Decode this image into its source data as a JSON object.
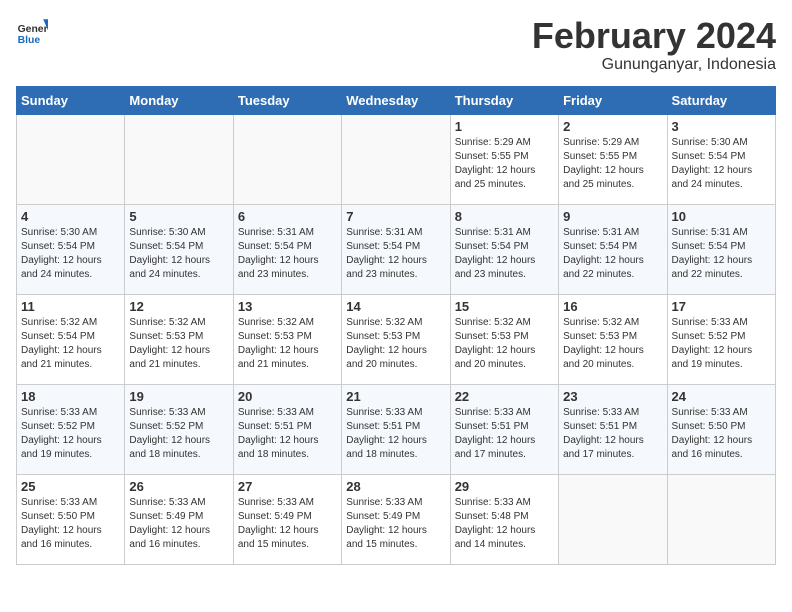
{
  "header": {
    "logo_general": "General",
    "logo_blue": "Blue",
    "month_title": "February 2024",
    "location": "Gununganyar, Indonesia"
  },
  "days_of_week": [
    "Sunday",
    "Monday",
    "Tuesday",
    "Wednesday",
    "Thursday",
    "Friday",
    "Saturday"
  ],
  "weeks": [
    [
      {
        "day": "",
        "empty": true
      },
      {
        "day": "",
        "empty": true
      },
      {
        "day": "",
        "empty": true
      },
      {
        "day": "",
        "empty": true
      },
      {
        "day": "1",
        "sunrise": "5:29 AM",
        "sunset": "5:55 PM",
        "daylight": "12 hours and 25 minutes."
      },
      {
        "day": "2",
        "sunrise": "5:29 AM",
        "sunset": "5:55 PM",
        "daylight": "12 hours and 25 minutes."
      },
      {
        "day": "3",
        "sunrise": "5:30 AM",
        "sunset": "5:54 PM",
        "daylight": "12 hours and 24 minutes."
      }
    ],
    [
      {
        "day": "4",
        "sunrise": "5:30 AM",
        "sunset": "5:54 PM",
        "daylight": "12 hours and 24 minutes."
      },
      {
        "day": "5",
        "sunrise": "5:30 AM",
        "sunset": "5:54 PM",
        "daylight": "12 hours and 24 minutes."
      },
      {
        "day": "6",
        "sunrise": "5:31 AM",
        "sunset": "5:54 PM",
        "daylight": "12 hours and 23 minutes."
      },
      {
        "day": "7",
        "sunrise": "5:31 AM",
        "sunset": "5:54 PM",
        "daylight": "12 hours and 23 minutes."
      },
      {
        "day": "8",
        "sunrise": "5:31 AM",
        "sunset": "5:54 PM",
        "daylight": "12 hours and 23 minutes."
      },
      {
        "day": "9",
        "sunrise": "5:31 AM",
        "sunset": "5:54 PM",
        "daylight": "12 hours and 22 minutes."
      },
      {
        "day": "10",
        "sunrise": "5:31 AM",
        "sunset": "5:54 PM",
        "daylight": "12 hours and 22 minutes."
      }
    ],
    [
      {
        "day": "11",
        "sunrise": "5:32 AM",
        "sunset": "5:54 PM",
        "daylight": "12 hours and 21 minutes."
      },
      {
        "day": "12",
        "sunrise": "5:32 AM",
        "sunset": "5:53 PM",
        "daylight": "12 hours and 21 minutes."
      },
      {
        "day": "13",
        "sunrise": "5:32 AM",
        "sunset": "5:53 PM",
        "daylight": "12 hours and 21 minutes."
      },
      {
        "day": "14",
        "sunrise": "5:32 AM",
        "sunset": "5:53 PM",
        "daylight": "12 hours and 20 minutes."
      },
      {
        "day": "15",
        "sunrise": "5:32 AM",
        "sunset": "5:53 PM",
        "daylight": "12 hours and 20 minutes."
      },
      {
        "day": "16",
        "sunrise": "5:32 AM",
        "sunset": "5:53 PM",
        "daylight": "12 hours and 20 minutes."
      },
      {
        "day": "17",
        "sunrise": "5:33 AM",
        "sunset": "5:52 PM",
        "daylight": "12 hours and 19 minutes."
      }
    ],
    [
      {
        "day": "18",
        "sunrise": "5:33 AM",
        "sunset": "5:52 PM",
        "daylight": "12 hours and 19 minutes."
      },
      {
        "day": "19",
        "sunrise": "5:33 AM",
        "sunset": "5:52 PM",
        "daylight": "12 hours and 18 minutes."
      },
      {
        "day": "20",
        "sunrise": "5:33 AM",
        "sunset": "5:51 PM",
        "daylight": "12 hours and 18 minutes."
      },
      {
        "day": "21",
        "sunrise": "5:33 AM",
        "sunset": "5:51 PM",
        "daylight": "12 hours and 18 minutes."
      },
      {
        "day": "22",
        "sunrise": "5:33 AM",
        "sunset": "5:51 PM",
        "daylight": "12 hours and 17 minutes."
      },
      {
        "day": "23",
        "sunrise": "5:33 AM",
        "sunset": "5:51 PM",
        "daylight": "12 hours and 17 minutes."
      },
      {
        "day": "24",
        "sunrise": "5:33 AM",
        "sunset": "5:50 PM",
        "daylight": "12 hours and 16 minutes."
      }
    ],
    [
      {
        "day": "25",
        "sunrise": "5:33 AM",
        "sunset": "5:50 PM",
        "daylight": "12 hours and 16 minutes."
      },
      {
        "day": "26",
        "sunrise": "5:33 AM",
        "sunset": "5:49 PM",
        "daylight": "12 hours and 16 minutes."
      },
      {
        "day": "27",
        "sunrise": "5:33 AM",
        "sunset": "5:49 PM",
        "daylight": "12 hours and 15 minutes."
      },
      {
        "day": "28",
        "sunrise": "5:33 AM",
        "sunset": "5:49 PM",
        "daylight": "12 hours and 15 minutes."
      },
      {
        "day": "29",
        "sunrise": "5:33 AM",
        "sunset": "5:48 PM",
        "daylight": "12 hours and 14 minutes."
      },
      {
        "day": "",
        "empty": true
      },
      {
        "day": "",
        "empty": true
      }
    ]
  ]
}
